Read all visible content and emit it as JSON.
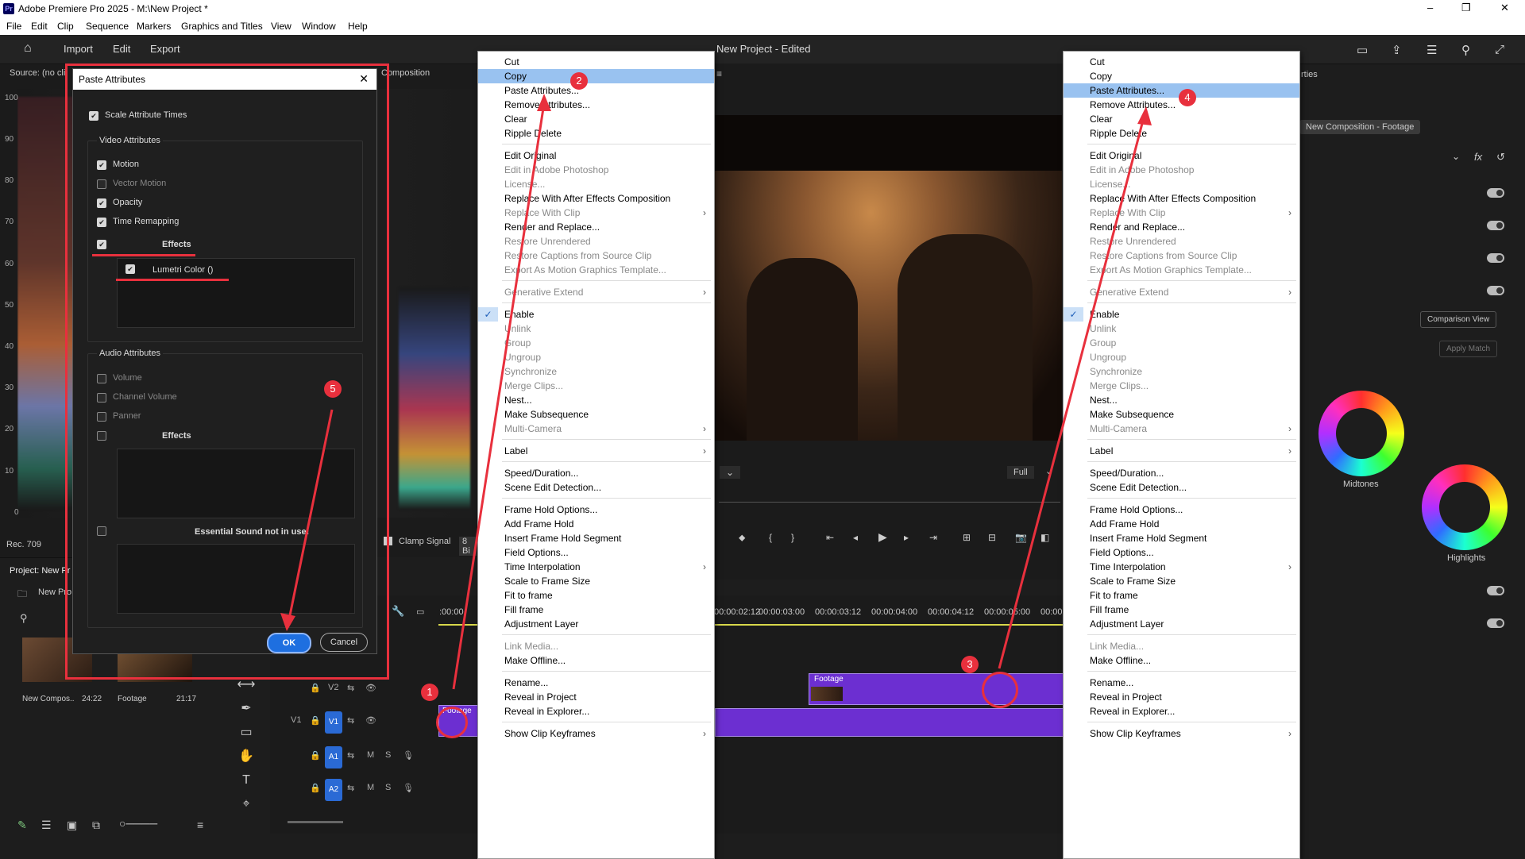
{
  "window": {
    "title": "Adobe Premiere Pro 2025 - M:\\New Project *",
    "app_icon": "Pr",
    "minimize": "–",
    "maximize": "❐",
    "close": "✕"
  },
  "menubar": [
    "File",
    "Edit",
    "Clip",
    "Sequence",
    "Markers",
    "Graphics and Titles",
    "View",
    "Window",
    "Help"
  ],
  "toolbar": {
    "tabs": [
      "Import",
      "Edit",
      "Export"
    ],
    "project_title": "New Project - Edited"
  },
  "source_panel": {
    "label": "Source: (no cli",
    "composition_tab": "Composition",
    "scale": [
      "100",
      "90",
      "80",
      "70",
      "60",
      "50",
      "40",
      "30",
      "20",
      "10",
      "0"
    ],
    "rec": "Rec. 709",
    "clamp_signal": "Clamp Signal",
    "bit": "8 Bi"
  },
  "project_panel": {
    "title": "Project: New Pr",
    "folder": "New Pro",
    "items": [
      {
        "name": "New Compos..",
        "duration": "24:22"
      },
      {
        "name": "Footage",
        "duration": "21:17"
      }
    ]
  },
  "dialog": {
    "title": "Paste Attributes",
    "scale_attr": "Scale Attribute Times",
    "video_header": "Video Attributes",
    "video_items": [
      {
        "label": "Motion",
        "checked": true,
        "disabled": false
      },
      {
        "label": "Vector Motion",
        "checked": false,
        "disabled": true
      },
      {
        "label": "Opacity",
        "checked": true,
        "disabled": false
      },
      {
        "label": "Time Remapping",
        "checked": true,
        "disabled": false
      }
    ],
    "effects_label": "Effects",
    "lumetri": "Lumetri Color ()",
    "audio_header": "Audio Attributes",
    "audio_items": [
      "Volume",
      "Channel Volume",
      "Panner"
    ],
    "audio_effects": "Effects",
    "essential_sound": "Essential Sound not in use!",
    "ok": "OK",
    "cancel": "Cancel"
  },
  "menu_left": {
    "items": [
      {
        "label": "Cut"
      },
      {
        "label": "Copy",
        "highlight": true
      },
      {
        "label": "Paste Attributes..."
      },
      {
        "label": "Remove Attributes..."
      },
      {
        "label": "Clear"
      },
      {
        "label": "Ripple Delete"
      },
      {
        "sep": true
      },
      {
        "label": "Edit Original"
      },
      {
        "label": "Edit in Adobe Photoshop",
        "disabled": true
      },
      {
        "label": "License...",
        "disabled": true
      },
      {
        "label": "Replace With After Effects Composition"
      },
      {
        "label": "Replace With Clip",
        "disabled": true,
        "sub": true
      },
      {
        "label": "Render and Replace..."
      },
      {
        "label": "Restore Unrendered",
        "disabled": true
      },
      {
        "label": "Restore Captions from Source Clip",
        "disabled": true
      },
      {
        "label": "Export As Motion Graphics Template...",
        "disabled": true
      },
      {
        "sep": true
      },
      {
        "label": "Generative Extend",
        "disabled": true,
        "sub": true
      },
      {
        "sep": true
      },
      {
        "label": "Enable",
        "checked": true
      },
      {
        "label": "Unlink",
        "disabled": true
      },
      {
        "label": "Group",
        "disabled": true
      },
      {
        "label": "Ungroup",
        "disabled": true
      },
      {
        "label": "Synchronize",
        "disabled": true
      },
      {
        "label": "Merge Clips...",
        "disabled": true
      },
      {
        "label": "Nest..."
      },
      {
        "label": "Make Subsequence"
      },
      {
        "label": "Multi-Camera",
        "disabled": true,
        "sub": true
      },
      {
        "sep": true
      },
      {
        "label": "Label",
        "sub": true
      },
      {
        "sep": true
      },
      {
        "label": "Speed/Duration..."
      },
      {
        "label": "Scene Edit Detection..."
      },
      {
        "sep": true
      },
      {
        "label": "Frame Hold Options..."
      },
      {
        "label": "Add Frame Hold"
      },
      {
        "label": "Insert Frame Hold Segment"
      },
      {
        "label": "Field Options..."
      },
      {
        "label": "Time Interpolation",
        "sub": true
      },
      {
        "label": "Scale to Frame Size"
      },
      {
        "label": "Fit to frame"
      },
      {
        "label": "Fill frame"
      },
      {
        "label": "Adjustment Layer"
      },
      {
        "sep": true
      },
      {
        "label": "Link Media...",
        "disabled": true
      },
      {
        "label": "Make Offline..."
      },
      {
        "sep": true
      },
      {
        "label": "Rename..."
      },
      {
        "label": "Reveal in Project"
      },
      {
        "label": "Reveal in Explorer..."
      },
      {
        "sep": true
      },
      {
        "label": "Show Clip Keyframes",
        "sub": true
      }
    ]
  },
  "menu_right": {
    "items": [
      {
        "label": "Cut"
      },
      {
        "label": "Copy"
      },
      {
        "label": "Paste Attributes...",
        "highlight": true
      },
      {
        "label": "Remove Attributes..."
      },
      {
        "label": "Clear"
      },
      {
        "label": "Ripple Delete"
      },
      {
        "sep": true
      },
      {
        "label": "Edit Original"
      },
      {
        "label": "Edit in Adobe Photoshop",
        "disabled": true
      },
      {
        "label": "License...",
        "disabled": true
      },
      {
        "label": "Replace With After Effects Composition"
      },
      {
        "label": "Replace With Clip",
        "disabled": true,
        "sub": true
      },
      {
        "label": "Render and Replace..."
      },
      {
        "label": "Restore Unrendered",
        "disabled": true
      },
      {
        "label": "Restore Captions from Source Clip",
        "disabled": true
      },
      {
        "label": "Export As Motion Graphics Template...",
        "disabled": true
      },
      {
        "sep": true
      },
      {
        "label": "Generative Extend",
        "disabled": true,
        "sub": true
      },
      {
        "sep": true
      },
      {
        "label": "Enable",
        "checked": true
      },
      {
        "label": "Unlink",
        "disabled": true
      },
      {
        "label": "Group",
        "disabled": true
      },
      {
        "label": "Ungroup",
        "disabled": true
      },
      {
        "label": "Synchronize",
        "disabled": true
      },
      {
        "label": "Merge Clips...",
        "disabled": true
      },
      {
        "label": "Nest..."
      },
      {
        "label": "Make Subsequence"
      },
      {
        "label": "Multi-Camera",
        "disabled": true,
        "sub": true
      },
      {
        "sep": true
      },
      {
        "label": "Label",
        "sub": true
      },
      {
        "sep": true
      },
      {
        "label": "Speed/Duration..."
      },
      {
        "label": "Scene Edit Detection..."
      },
      {
        "sep": true
      },
      {
        "label": "Frame Hold Options..."
      },
      {
        "label": "Add Frame Hold"
      },
      {
        "label": "Insert Frame Hold Segment"
      },
      {
        "label": "Field Options..."
      },
      {
        "label": "Time Interpolation",
        "sub": true
      },
      {
        "label": "Scale to Frame Size"
      },
      {
        "label": "Fit to frame"
      },
      {
        "label": "Fill frame"
      },
      {
        "label": "Adjustment Layer"
      },
      {
        "sep": true
      },
      {
        "label": "Link Media...",
        "disabled": true
      },
      {
        "label": "Make Offline..."
      },
      {
        "sep": true
      },
      {
        "label": "Rename..."
      },
      {
        "label": "Reveal in Project"
      },
      {
        "label": "Reveal in Explorer..."
      },
      {
        "sep": true
      },
      {
        "label": "Show Clip Keyframes",
        "sub": true
      }
    ]
  },
  "program": {
    "zoom": "Full"
  },
  "timeline": {
    "timecodes": [
      ":00:00",
      "00:00:02:12",
      "00:00:03:00",
      "00:00:03:12",
      "00:00:04:00",
      "00:00:04:12",
      "00:00:05:00",
      "00:00"
    ],
    "tracks": [
      "V2",
      "V1",
      "A1",
      "A2"
    ],
    "footage_clip": "Footage",
    "footage_clip_small": "Footage"
  },
  "right_panel": {
    "tab": "rties",
    "composition_chip": "New Composition - Footage",
    "comparison_view": "Comparison View",
    "apply_match": "Apply Match",
    "midtones": "Midtones",
    "highlights": "Highlights"
  },
  "annotations": {
    "b1": "1",
    "b2": "2",
    "b3": "3",
    "b4": "4",
    "b5": "5"
  },
  "colors": {
    "accent": "#2a6ad5",
    "annotation_red": "#e8303d",
    "clip_purple": "#6c2fd1",
    "menu_highlight": "#99c2f0"
  }
}
